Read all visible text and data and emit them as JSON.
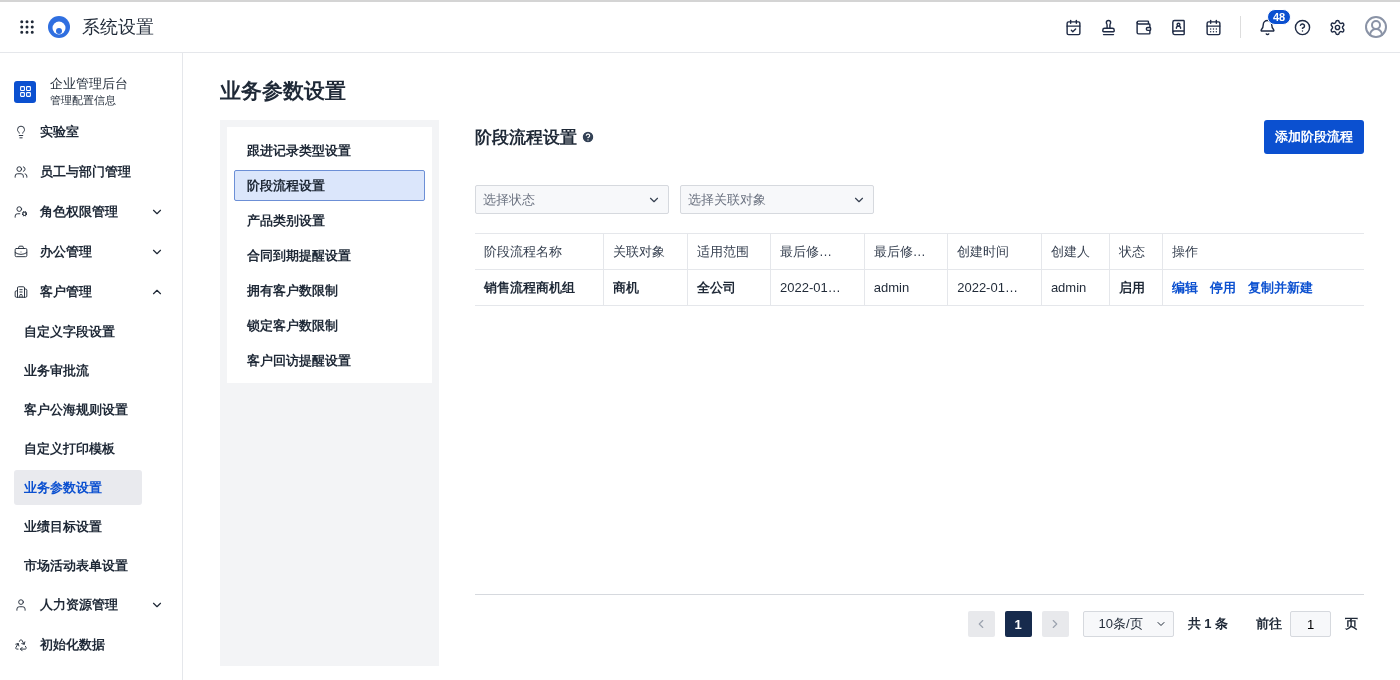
{
  "header": {
    "app_title": "系统设置",
    "notification_count": "48"
  },
  "sidebar": {
    "org": {
      "title": "企业管理后台",
      "subtitle": "管理配置信息"
    },
    "items": [
      {
        "label": "实验室"
      },
      {
        "label": "员工与部门管理"
      },
      {
        "label": "角色权限管理",
        "expanded": false
      },
      {
        "label": "办公管理",
        "expanded": false
      },
      {
        "label": "客户管理",
        "expanded": true,
        "children": [
          {
            "label": "自定义字段设置",
            "selected": false
          },
          {
            "label": "业务审批流",
            "selected": false
          },
          {
            "label": "客户公海规则设置",
            "selected": false
          },
          {
            "label": "自定义打印模板",
            "selected": false
          },
          {
            "label": "业务参数设置",
            "selected": true
          },
          {
            "label": "业绩目标设置",
            "selected": false
          },
          {
            "label": "市场活动表单设置",
            "selected": false
          }
        ]
      },
      {
        "label": "人力资源管理",
        "expanded": false
      },
      {
        "label": "初始化数据"
      }
    ]
  },
  "page_title": "业务参数设置",
  "sub_nav": [
    {
      "label": "跟进记录类型设置",
      "selected": false
    },
    {
      "label": "阶段流程设置",
      "selected": true
    },
    {
      "label": "产品类别设置",
      "selected": false
    },
    {
      "label": "合同到期提醒设置",
      "selected": false
    },
    {
      "label": "拥有客户数限制",
      "selected": false
    },
    {
      "label": "锁定客户数限制",
      "selected": false
    },
    {
      "label": "客户回访提醒设置",
      "selected": false
    }
  ],
  "section": {
    "title": "阶段流程设置",
    "add_button": "添加阶段流程",
    "filters": [
      {
        "placeholder": "选择状态"
      },
      {
        "placeholder": "选择关联对象"
      }
    ],
    "table": {
      "columns": [
        "阶段流程名称",
        "关联对象",
        "适用范围",
        "最后修…",
        "最后修…",
        "创建时间",
        "创建人",
        "状态",
        "操作"
      ],
      "rows": [
        {
          "cells": [
            "销售流程商机组",
            "商机",
            "全公司",
            "2022-01…",
            "admin",
            "2022-01…",
            "admin",
            "启用"
          ],
          "actions": [
            "编辑",
            "停用",
            "复制并新建"
          ]
        }
      ]
    },
    "pagination": {
      "current_page": "1",
      "page_size": "10条/页",
      "total": "共 1 条",
      "goto_label": "前往",
      "goto_value": "1",
      "page_suffix": "页"
    }
  }
}
